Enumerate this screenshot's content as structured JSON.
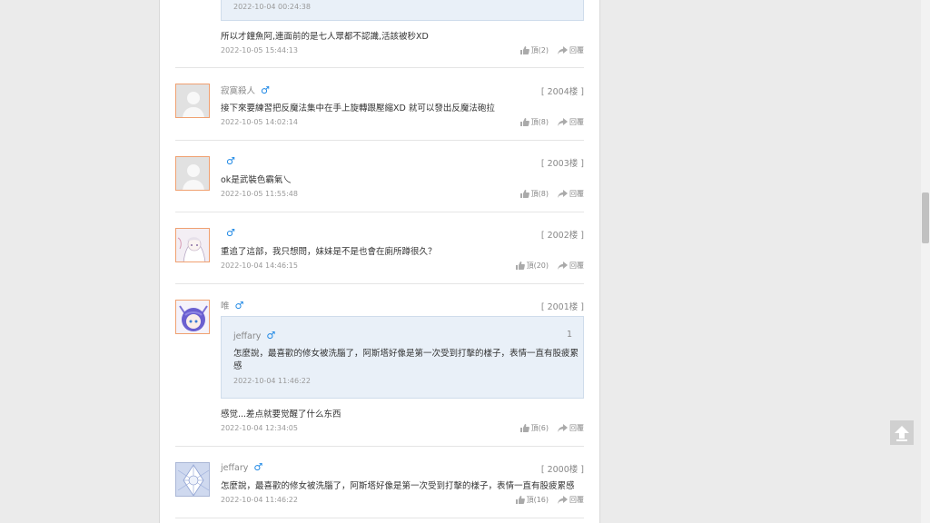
{
  "top_quote": {
    "time": "2022-10-04 00:24:38"
  },
  "comment_top": {
    "text": "所以才鐘魚阿,連面前的是七人眾都不認識,活該被秒XD",
    "time": "2022-10-05 15:44:13",
    "like": "頂(2)",
    "reply": "回覆"
  },
  "comments": [
    {
      "user": "寂寞殺人",
      "gender": "♂",
      "floor": "[ 2004楼 ]",
      "text": "接下來要練習把反魔法集中在手上旋轉跟壓縮XD 就可以發出反魔法砲拉",
      "time": "2022-10-05 14:02:14",
      "like": "頂(8)",
      "reply": "回覆"
    },
    {
      "user": "",
      "gender": "♂",
      "floor": "[ 2003楼 ]",
      "text": "ok是武裝色霸氣乀",
      "time": "2022-10-05 11:55:48",
      "like": "頂(8)",
      "reply": "回覆"
    },
    {
      "user": "",
      "gender": "♂",
      "floor": "[ 2002楼 ]",
      "text": "重追了這部，我只想問，妹妹是不是也會在廁所蹲很久？",
      "time": "2022-10-04 14:46:15",
      "like": "頂(20)",
      "reply": "回覆"
    },
    {
      "user": "唯",
      "gender": "♂",
      "floor": "[ 2001楼 ]",
      "quote": {
        "user": "jeffary",
        "gender": "♂",
        "num": "1",
        "text1": "怎麼說，最喜歡的修女被洗腦了，阿斯塔好像是第一次受到打擊的樣子，表情一直有股疲累",
        "text2": "感",
        "time": "2022-10-04 11:46:22"
      },
      "text": "感觉...差点就要觉醒了什么东西",
      "time": "2022-10-04 12:34:05",
      "like": "頂(6)",
      "reply": "回覆"
    },
    {
      "user": "jeffary",
      "gender": "♂",
      "floor": "[ 2000楼 ]",
      "text": "怎麼說，最喜歡的修女被洗腦了，阿斯塔好像是第一次受到打擊的樣子，表情一直有股疲累感",
      "time": "2022-10-04 11:46:22",
      "like": "頂(16)",
      "reply": "回覆"
    }
  ],
  "colors": {
    "accent": "#1e88e5",
    "quote_bg": "#e9f0f8",
    "avatar_border": "#f0a070"
  },
  "icons": {
    "like": "thumbs-up-icon",
    "reply": "share-arrow-icon",
    "gender": "male-icon",
    "scroll_top": "arrow-up-icon"
  }
}
